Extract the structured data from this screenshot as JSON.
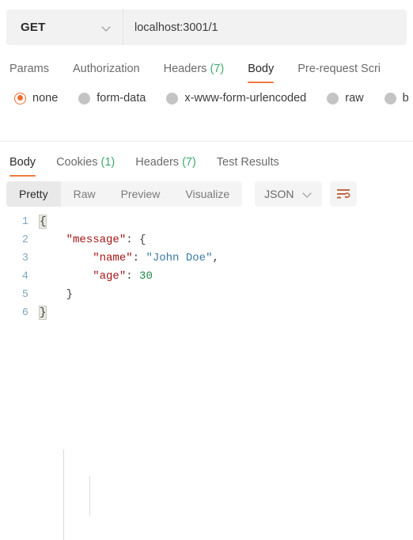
{
  "request": {
    "method": "GET",
    "method_icon": "chevron-down-icon",
    "url": "localhost:3001/1",
    "url_placeholder": "Enter request URL",
    "tabs": [
      {
        "label": "Params",
        "active": false
      },
      {
        "label": "Authorization",
        "active": false
      },
      {
        "label": "Headers",
        "count": "(7)",
        "active": false
      },
      {
        "label": "Body",
        "active": true
      },
      {
        "label": "Pre-request Scri",
        "active": false
      }
    ],
    "body_types": [
      {
        "label": "none",
        "selected": true
      },
      {
        "label": "form-data",
        "selected": false
      },
      {
        "label": "x-www-form-urlencoded",
        "selected": false
      },
      {
        "label": "raw",
        "selected": false
      },
      {
        "label": "b",
        "selected": false
      }
    ]
  },
  "response": {
    "tabs": [
      {
        "label": "Body",
        "active": true
      },
      {
        "label": "Cookies",
        "count": "(1)",
        "active": false
      },
      {
        "label": "Headers",
        "count": "(7)",
        "active": false
      },
      {
        "label": "Test Results",
        "active": false
      }
    ],
    "view_modes": [
      {
        "label": "Pretty",
        "active": true
      },
      {
        "label": "Raw",
        "active": false
      },
      {
        "label": "Preview",
        "active": false
      },
      {
        "label": "Visualize",
        "active": false
      }
    ],
    "format": "JSON",
    "format_icon": "chevron-down-icon",
    "wrap_icon": "word-wrap-icon",
    "code_lines": [
      {
        "num": "1",
        "segments": [
          {
            "t": "{",
            "c": "p",
            "hl": true
          }
        ]
      },
      {
        "num": "2",
        "segments": [
          {
            "t": "    ",
            "c": "p"
          },
          {
            "t": "\"message\"",
            "c": "k"
          },
          {
            "t": ": ",
            "c": "p"
          },
          {
            "t": "{",
            "c": "p"
          }
        ]
      },
      {
        "num": "3",
        "segments": [
          {
            "t": "        ",
            "c": "p"
          },
          {
            "t": "\"name\"",
            "c": "k"
          },
          {
            "t": ": ",
            "c": "p"
          },
          {
            "t": "\"John Doe\"",
            "c": "s"
          },
          {
            "t": ",",
            "c": "p"
          }
        ]
      },
      {
        "num": "4",
        "segments": [
          {
            "t": "        ",
            "c": "p"
          },
          {
            "t": "\"age\"",
            "c": "k"
          },
          {
            "t": ": ",
            "c": "p"
          },
          {
            "t": "30",
            "c": "n"
          }
        ]
      },
      {
        "num": "5",
        "segments": [
          {
            "t": "    ",
            "c": "p"
          },
          {
            "t": "}",
            "c": "p"
          }
        ]
      },
      {
        "num": "6",
        "segments": [
          {
            "t": "}",
            "c": "p",
            "hl": true
          }
        ]
      }
    ]
  },
  "colors": {
    "accent": "#ef7a3d",
    "radio_selected": "#ef6c2e",
    "count_green": "#3bab6d",
    "json_key": "#a31515",
    "json_string": "#3a7ca5",
    "json_number": "#1f8a4c",
    "lineno": "#7fa8c4"
  }
}
